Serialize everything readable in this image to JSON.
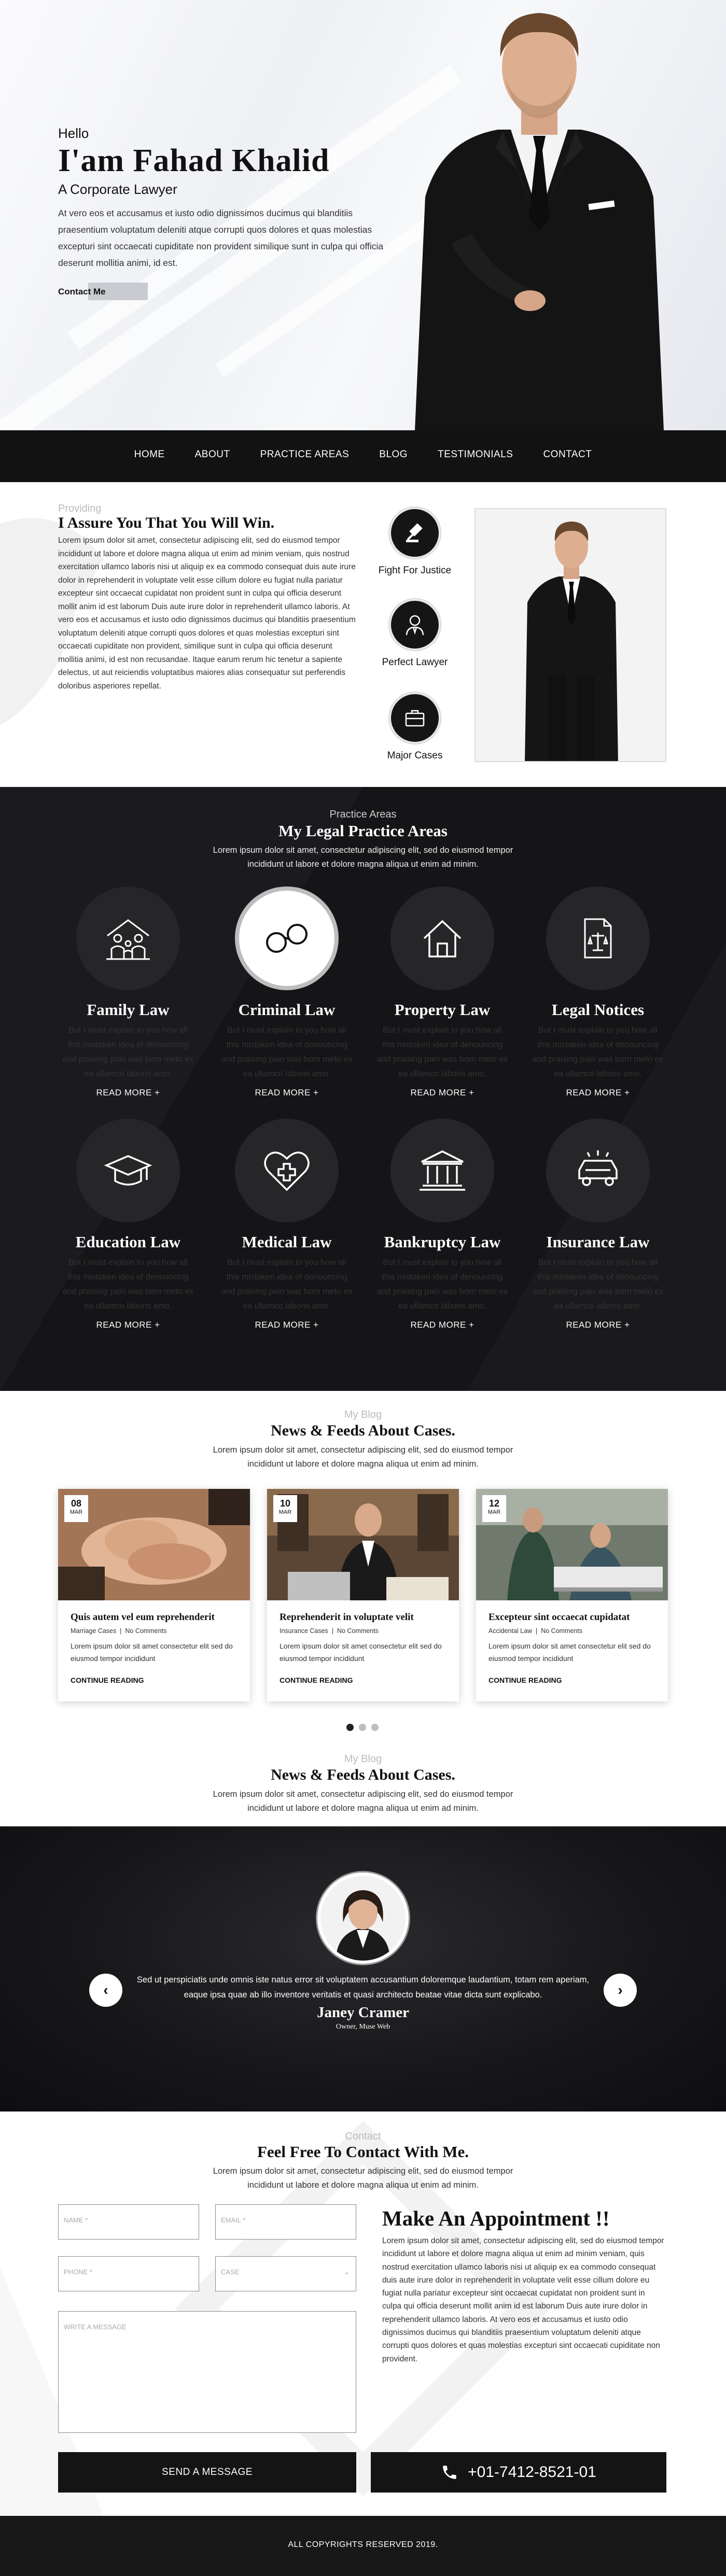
{
  "hero": {
    "hello": "Hello",
    "name": "I'am Fahad Khalid",
    "role": "A Corporate Lawyer",
    "description": "At vero eos et accusamus et iusto odio dignissimos ducimus qui blanditiis praesentium voluptatum deleniti atque corrupti quos dolores et quas molestias excepturi sint occaecati cupiditate non provident similique sunt in culpa qui officia deserunt mollitia animi, id est.",
    "contact_label": "Contact Me"
  },
  "nav": {
    "items": [
      "HOME",
      "ABOUT",
      "PRACTICE AREAS",
      "BLOG",
      "TESTIMONIALS",
      "CONTACT"
    ]
  },
  "about": {
    "subtitle": "Providing",
    "title": "I Assure You That You Will Win.",
    "body": "Lorem ipsum dolor sit amet, consectetur adipiscing elit, sed do eiusmod tempor incididunt ut labore et dolore magna aliqua ut enim ad minim veniam, quis nostrud exercitation ullamco laboris nisi ut aliquip ex ea commodo consequat duis aute irure dolor in reprehenderit in voluptate velit esse cillum dolore eu fugiat nulla pariatur excepteur sint occaecat cupidatat non proident sunt in culpa qui officia deserunt mollit anim id est laborum Duis aute irure dolor in reprehenderit ullamco laboris. At vero eos et accusamus et iusto odio dignissimos ducimus qui blanditiis praesentium voluptatum deleniti atque corrupti quos dolores et quas molestias excepturi sint occaecati cupiditate non provident, similique sunt in culpa qui officia deserunt mollitia animi, id est non recusandae. Itaque earum rerum hic tenetur a sapiente delectus, ut aut reiciendis voluptatibus maiores alias consequatur sut perferendis doloribus asperiores repellat.",
    "features": [
      {
        "label": "Fight For Justice",
        "icon": "gavel-icon"
      },
      {
        "label": "Perfect Lawyer",
        "icon": "lawyer-icon"
      },
      {
        "label": "Major Cases",
        "icon": "briefcase-icon"
      }
    ]
  },
  "practice": {
    "subtitle": "Practice Areas",
    "title": "My Legal Practice Areas",
    "description": "Lorem ipsum dolor sit amet, consectetur adipiscing elit, sed do eiusmod tempor incididunt ut labore et dolore magna aliqua ut enim ad minim.",
    "card_text": "But I must explain to you how all this mistaken idea of denouncing and praising pain was born meto ex ea ullamco laboris amo.",
    "read_more": "READ MORE +",
    "cards": [
      {
        "title": "Family Law",
        "icon": "family-icon"
      },
      {
        "title": "Criminal Law",
        "icon": "handcuffs-icon"
      },
      {
        "title": "Property Law",
        "icon": "house-icon"
      },
      {
        "title": "Legal Notices",
        "icon": "legal-document-icon"
      },
      {
        "title": "Education Law",
        "icon": "graduation-cap-icon"
      },
      {
        "title": "Medical Law",
        "icon": "medical-heart-icon"
      },
      {
        "title": "Bankruptcy Law",
        "icon": "bank-icon"
      },
      {
        "title": "Insurance Law",
        "icon": "car-insurance-icon"
      }
    ]
  },
  "blog": {
    "subtitle": "My Blog",
    "title": "News & Feeds About Cases.",
    "description": "Lorem ipsum dolor sit amet, consectetur adipiscing elit, sed do eiusmod tempor incididunt ut labore et dolore magna aliqua ut enim ad minim.",
    "continue": "CONTINUE READING",
    "excerpt": "Lorem ipsum dolor sit amet consectetur elit sed do eiusmod tempor incididunt",
    "posts": [
      {
        "day": "08",
        "month": "MAR",
        "title": "Quis autem vel eum reprehenderit",
        "category": "Marriage Cases",
        "comments": "No Comments"
      },
      {
        "day": "10",
        "month": "MAR",
        "title": "Reprehenderit in voluptate velit",
        "category": "Insurance Cases",
        "comments": "No Comments"
      },
      {
        "day": "12",
        "month": "MAR",
        "title": "Excepteur sint occaecat cupidatat",
        "category": "Accidental Law",
        "comments": "No Comments"
      }
    ]
  },
  "blog2": {
    "subtitle": "My Blog",
    "title": "News & Feeds About Cases.",
    "description": "Lorem ipsum dolor sit amet, consectetur adipiscing elit, sed do eiusmod tempor incididunt ut labore et dolore magna aliqua ut enim ad minim."
  },
  "testimonial": {
    "quote": "Sed ut perspiciatis unde omnis iste natus error sit voluptatem accusantium doloremque laudantium, totam rem aperiam, eaque ipsa quae ab illo inventore veritatis et quasi architecto beatae vitae dicta sunt explicabo.",
    "name": "Janey Cramer",
    "role": "Owner, Muse Web",
    "prev_icon": "chevron-left-icon",
    "next_icon": "chevron-right-icon"
  },
  "contact": {
    "subtitle": "Contact",
    "title": "Feel Free To Contact With Me.",
    "description": "Lorem ipsum dolor sit amet, consectetur adipiscing elit, sed do eiusmod tempor incididunt ut labore et dolore magna aliqua ut enim ad minim.",
    "placeholders": {
      "name": "NAME *",
      "email": "EMAIL *",
      "phone": "PHONE *",
      "case": "CASE",
      "message": "WRITE A MESSAGE"
    },
    "appointment_title": "Make An Appointment !!",
    "appointment_body": "Lorem ipsum dolor sit amet, consectetur adipiscing elit, sed do eiusmod tempor incididunt ut labore et dolore magna aliqua ut enim ad minim veniam, quis nostrud exercitation ullamco laboris nisi ut aliquip ex ea commodo consequat duis aute irure dolor in reprehenderit in voluptate velit esse cillum dolore eu fugiat nulla pariatur excepteur sint occaecat cupidatat non proident sunt in culpa qui officia deserunt mollit anim id est laborum Duis aute irure dolor in reprehenderit ullamco laboris. At vero eos et accusamus et iusto odio dignissimos ducimus qui blanditiis praesentium voluptatum deleniti atque corrupti quos dolores et quas molestias excepturi sint occaecati cupiditate non provident.",
    "send_label": "SEND A MESSAGE",
    "phone": "+01-7412-8521-01"
  },
  "footer": {
    "copyright": "ALL COPYRIGHTS RESERVED 2019."
  }
}
